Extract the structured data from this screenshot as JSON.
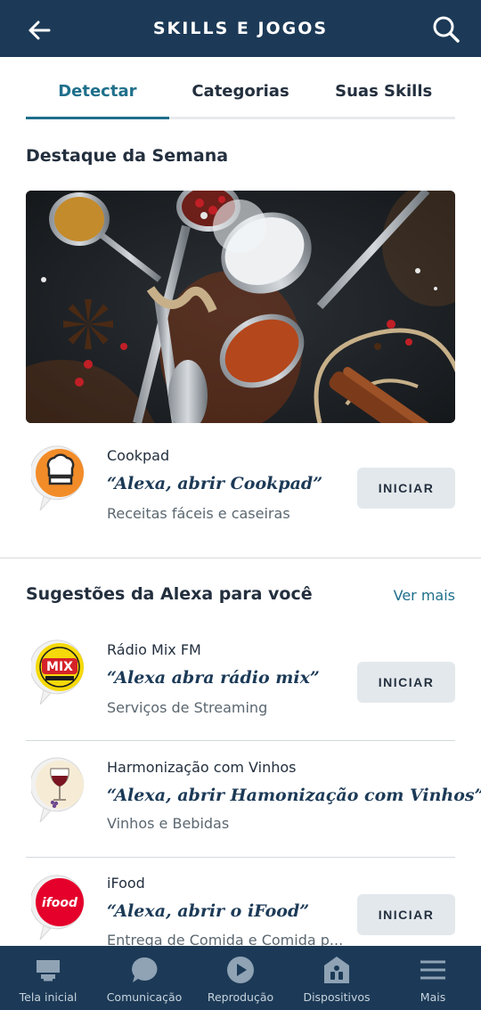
{
  "header": {
    "title": "SKILLS E JOGOS"
  },
  "tabs": [
    {
      "label": "Detectar",
      "active": true
    },
    {
      "label": "Categorias",
      "active": false
    },
    {
      "label": "Suas Skills",
      "active": false
    }
  ],
  "featured": {
    "title": "Destaque da Semana",
    "skill": {
      "name": "Cookpad",
      "phrase": "“Alexa, abrir Cookpad”",
      "category": "Receitas fáceis e caseiras",
      "button": "INICIAR",
      "icon": "chef-hat-icon"
    }
  },
  "suggestions": {
    "title": "Sugestões da Alexa para você",
    "see_more": "Ver mais",
    "items": [
      {
        "name": "Rádio Mix FM",
        "phrase": "“Alexa abra rádio mix”",
        "category": "Serviços de Streaming",
        "button": "INICIAR",
        "icon": "radio-mix-logo",
        "icon_text": "MIX"
      },
      {
        "name": "Harmonização com Vinhos",
        "phrase": "“Alexa, abrir Hamonização com Vinhos”",
        "category": "Vinhos e Bebidas",
        "icon": "wine-glass-icon"
      },
      {
        "name": "iFood",
        "phrase": "“Alexa, abrir o iFood”",
        "category": "Entrega de Comida e Comida p...",
        "button": "INICIAR",
        "icon": "ifood-logo",
        "icon_text": "ifood"
      }
    ]
  },
  "bottom_nav": [
    {
      "label": "Tela inicial",
      "icon": "home-icon"
    },
    {
      "label": "Comunicação",
      "icon": "chat-bubble-icon"
    },
    {
      "label": "Reprodução",
      "icon": "play-icon"
    },
    {
      "label": "Dispositivos",
      "icon": "devices-icon"
    },
    {
      "label": "Mais",
      "icon": "menu-icon"
    }
  ],
  "colors": {
    "header_bg": "#1c3a57",
    "accent": "#1f6f8b",
    "button_bg": "#e3e8ec"
  }
}
